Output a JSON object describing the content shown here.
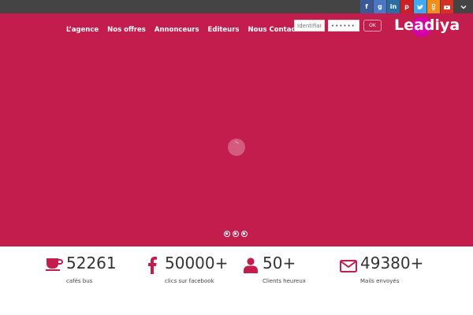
{
  "social": [
    {
      "name": "facebook",
      "icon": "facebook-icon",
      "glyph": "f",
      "color": "#3b5998"
    },
    {
      "name": "google-plus",
      "icon": "google-plus-icon",
      "glyph": "g",
      "color": "#4a76c8"
    },
    {
      "name": "linkedin",
      "icon": "linkedin-icon",
      "glyph": "in",
      "color": "#2a6da3"
    },
    {
      "name": "pinterest",
      "icon": "pinterest-icon",
      "glyph": "p",
      "color": "#cb2027"
    },
    {
      "name": "twitter",
      "icon": "twitter-icon",
      "glyph": "",
      "color": "#3fa9f5"
    },
    {
      "name": "odnoklassniki",
      "icon": "odnoklassniki-icon",
      "glyph": "",
      "color": "#f28c1a"
    },
    {
      "name": "youtube",
      "icon": "youtube-icon",
      "glyph": "",
      "color": "#d93025"
    }
  ],
  "nav": {
    "items": [
      "L’agence",
      "Nos offres",
      "Annonceurs",
      "Editeurs",
      "Nous Contacter"
    ]
  },
  "login": {
    "username_placeholder": "Identifiant",
    "password_value": "••••••••",
    "submit_label": "OK"
  },
  "logo": {
    "text": "Leadiya"
  },
  "colors": {
    "brand": "#c21d4d",
    "topbar": "#444444",
    "logo_dot": "#d500a8"
  },
  "slider": {
    "dots": 3
  },
  "stats": [
    {
      "icon": "coffee-cup-icon",
      "value": "52261",
      "label": "cafés bus"
    },
    {
      "icon": "facebook-icon",
      "value": "50000+",
      "label": "clics sur facebook"
    },
    {
      "icon": "user-icon",
      "value": "50+",
      "label": "Clients heureux"
    },
    {
      "icon": "envelope-icon",
      "value": "49380+",
      "label": "Mails envoyés"
    }
  ]
}
